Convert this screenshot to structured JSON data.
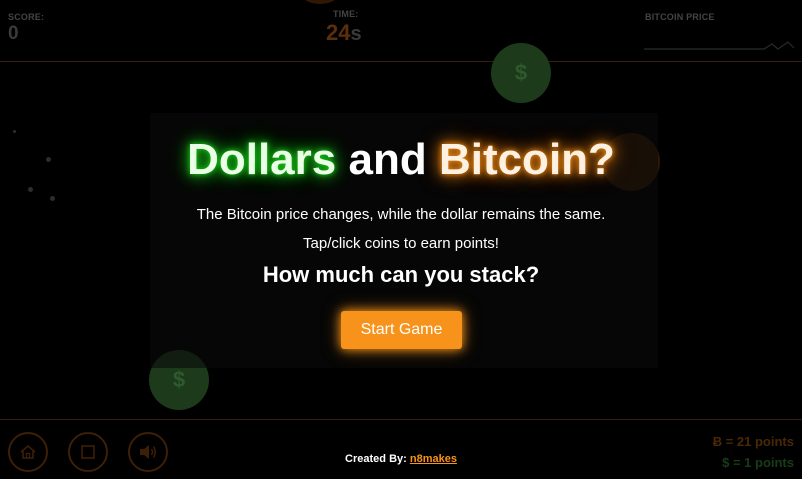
{
  "hud": {
    "score_label": "SCORE:",
    "score_value": "0",
    "time_label": "TIME:",
    "time_value": "24",
    "time_unit": "s",
    "bitcoin_price_label": "BITCOIN PRICE"
  },
  "modal": {
    "title_dollars": "Dollars",
    "title_and": "and",
    "title_bitcoin": "Bitcoin?",
    "line1": "The Bitcoin price changes, while the dollar remains the same.",
    "line2": "Tap/click coins to earn points!",
    "headline": "How much can you stack?",
    "start_button": "Start Game"
  },
  "footer": {
    "created_by": "Created By:",
    "author": "n8makes",
    "legend_btc": "Ƀ = 21 points",
    "legend_usd": "$ = 1 points"
  },
  "coins": {
    "dollar_symbol": "$"
  },
  "colors": {
    "accent_orange": "#f7931a",
    "accent_green": "#1bd41b",
    "background": "#000000"
  },
  "icons": [
    "home-icon",
    "stop-icon",
    "speaker-icon",
    "dollar-coin-icon",
    "bitcoin-coin-icon"
  ]
}
